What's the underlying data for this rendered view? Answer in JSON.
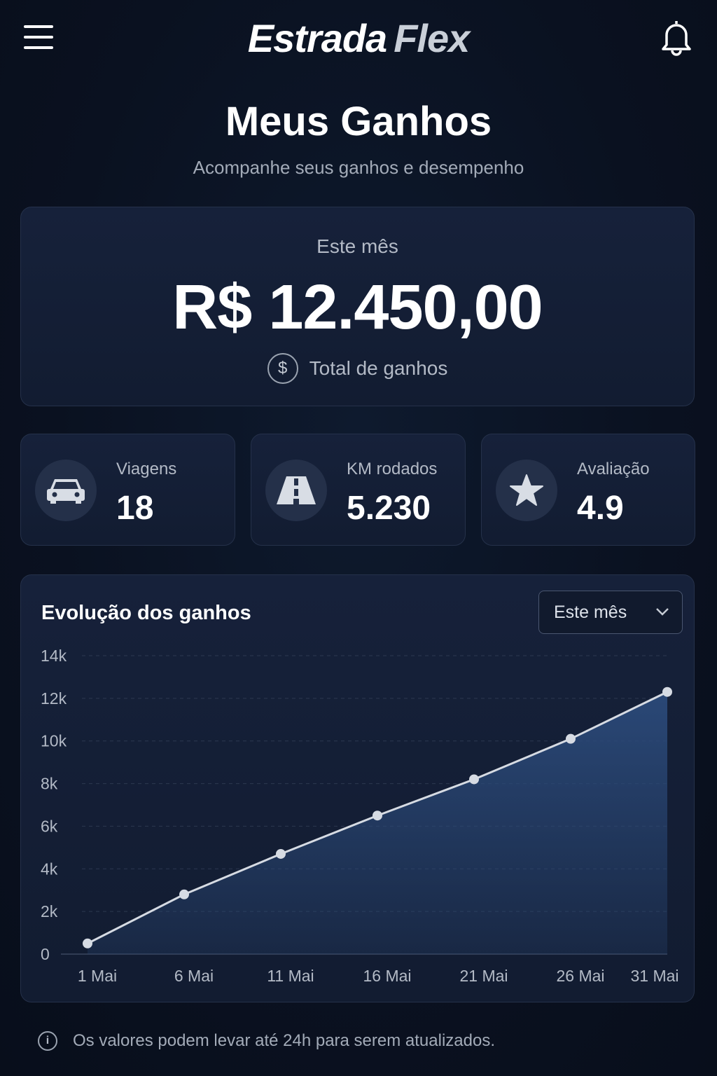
{
  "header": {
    "logo_part1": "Estrada",
    "logo_part2": "Flex",
    "menu_icon": "hamburger-menu-icon",
    "notification_icon": "bell-icon"
  },
  "page": {
    "title": "Meus Ganhos",
    "subtitle": "Acompanhe seus ganhos e desempenho"
  },
  "summary": {
    "period_label": "Este mês",
    "total_amount": "R$ 12.450,00",
    "total_label": "Total de ganhos",
    "icon": "dollar-circle-icon"
  },
  "stats": [
    {
      "label": "Viagens",
      "value": "18",
      "icon": "car-icon"
    },
    {
      "label": "KM rodados",
      "value": "5.230",
      "icon": "road-icon"
    },
    {
      "label": "Avaliação",
      "value": "4.9",
      "icon": "star-icon"
    }
  ],
  "chart_section": {
    "title": "Evolução dos ganhos",
    "period_select": "Este mês"
  },
  "chart_data": {
    "type": "area",
    "title": "Evolução dos ganhos",
    "x": [
      "1 Mai",
      "6 Mai",
      "11 Mai",
      "16 Mai",
      "21 Mai",
      "26 Mai",
      "31 Mai"
    ],
    "series": [
      {
        "values": [
          500,
          2800,
          4700,
          6500,
          8200,
          10100,
          12300
        ]
      }
    ],
    "y_ticks": [
      "0",
      "2k",
      "4k",
      "6k",
      "8k",
      "10k",
      "12k",
      "14k"
    ],
    "ylim": [
      0,
      14000
    ],
    "grid": true,
    "colors": {
      "line": "#d6dbe3",
      "fill": "#2b4a7a",
      "point": "#d6dbe3"
    }
  },
  "footer": {
    "note": "Os valores podem levar até 24h para serem atualizados.",
    "icon": "info-icon"
  },
  "colors": {
    "background": "#0a1120",
    "card": "#141f36",
    "muted_text": "#a3abb8"
  }
}
